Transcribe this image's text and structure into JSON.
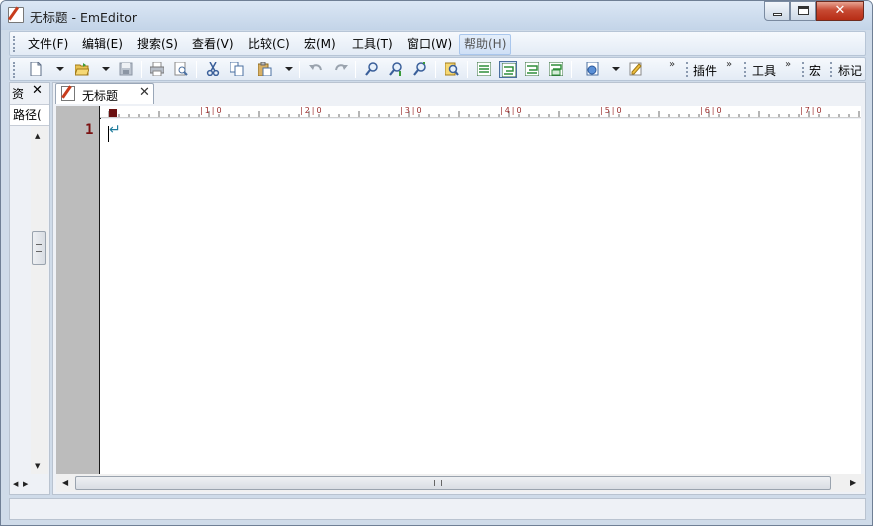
{
  "window": {
    "title": "无标题 - EmEditor",
    "close_glyph": "✕"
  },
  "menu": [
    {
      "label": "文件(F)"
    },
    {
      "label": "编辑(E)"
    },
    {
      "label": "搜索(S)"
    },
    {
      "label": "查看(V)"
    },
    {
      "label": "比较(C)"
    },
    {
      "label": "宏(M)"
    },
    {
      "label": "工具(T)"
    },
    {
      "label": "窗口(W)"
    },
    {
      "label": "帮助(H)"
    }
  ],
  "toolbar": {
    "chevron": "»",
    "plugins_label": "插件",
    "tools_label": "工具",
    "macros_label": "宏",
    "markers_label": "标记"
  },
  "side_panel": {
    "tab_label": "资",
    "close_glyph": "✕",
    "header": "路径(",
    "scroll_up": "▲",
    "scroll_down": "▼",
    "scroll_left": "◀",
    "scroll_right": "▶"
  },
  "document": {
    "tab_label": "无标题",
    "tab_close_glyph": "✕",
    "line_number": "1",
    "eol_marker": "↵"
  },
  "ruler": {
    "labels": [
      "|1|0",
      "|2|0",
      "|3|0",
      "|4|0",
      "|5|0",
      "|6|0",
      "|7|0"
    ]
  },
  "hscroll": {
    "left": "◀",
    "right": "▶"
  },
  "colors": {
    "line_number": "#7b1212",
    "gutter": "#bcbcbc",
    "ruler_numbers": "#9c2c2c",
    "close_button": "#c74a33"
  }
}
